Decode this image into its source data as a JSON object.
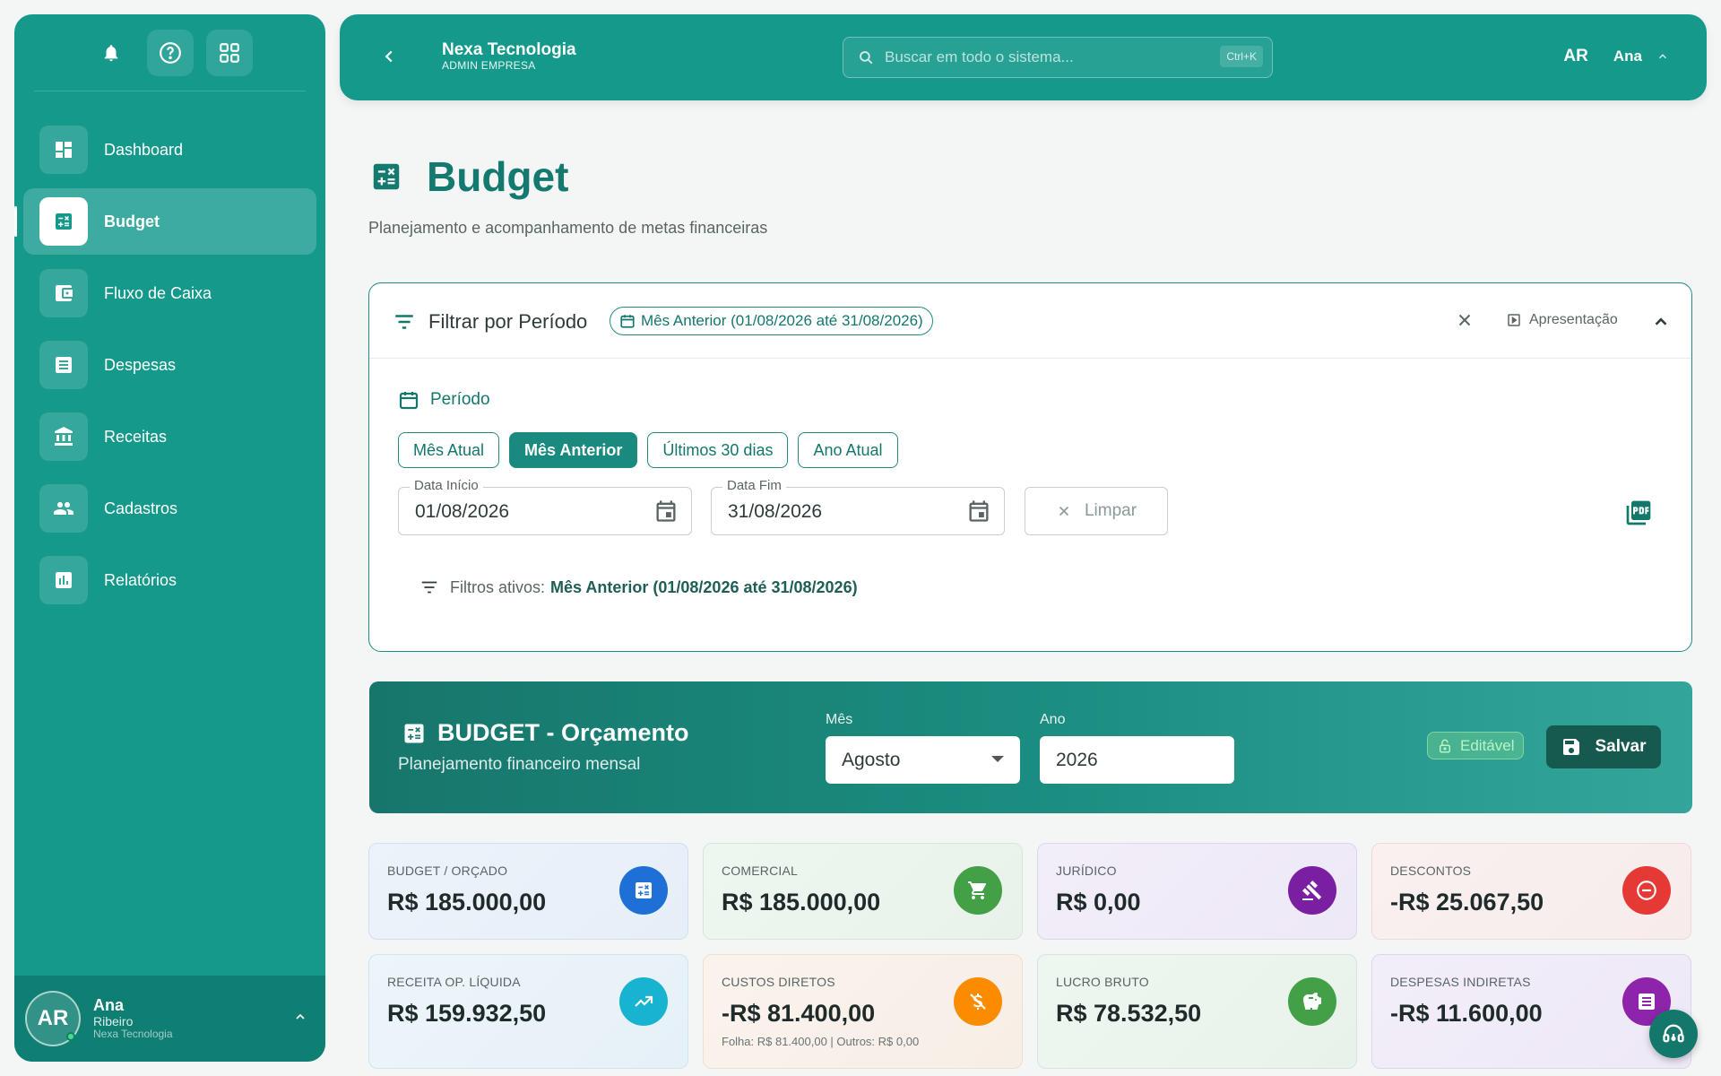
{
  "sidebar": {
    "items": [
      {
        "label": "Dashboard",
        "icon": "dashboard-icon"
      },
      {
        "label": "Budget",
        "icon": "calculator-icon",
        "active": true
      },
      {
        "label": "Fluxo de Caixa",
        "icon": "wallet-icon"
      },
      {
        "label": "Despesas",
        "icon": "receipt-icon"
      },
      {
        "label": "Receitas",
        "icon": "bank-icon"
      },
      {
        "label": "Cadastros",
        "icon": "people-icon"
      },
      {
        "label": "Relatórios",
        "icon": "bar-chart-icon"
      }
    ],
    "user": {
      "initials": "AR",
      "first_name": "Ana",
      "last_name": "Ribeiro",
      "company": "Nexa Tecnologia"
    }
  },
  "header": {
    "company": "Nexa Tecnologia",
    "role": "ADMIN EMPRESA",
    "search_placeholder": "Buscar em todo o sistema...",
    "shortcut": "Ctrl+K",
    "user_initials": "AR",
    "user_name": "Ana"
  },
  "page": {
    "title": "Budget",
    "subtitle": "Planejamento e acompanhamento de metas financeiras"
  },
  "filter": {
    "title": "Filtrar por Período",
    "chip": "Mês Anterior (01/08/2026 até 31/08/2026)",
    "presentation": "Apresentação",
    "period_label": "Período",
    "presets": [
      "Mês Atual",
      "Mês Anterior",
      "Últimos 30 dias",
      "Ano Atual"
    ],
    "start_label": "Data Início",
    "start_value": "01/08/2026",
    "end_label": "Data Fim",
    "end_value": "31/08/2026",
    "clear_label": "Limpar",
    "active_label": "Filtros ativos:",
    "active_value": "Mês Anterior (01/08/2026 até 31/08/2026)"
  },
  "budget": {
    "title": "BUDGET - Orçamento",
    "subtitle": "Planejamento financeiro mensal",
    "month_label": "Mês",
    "month_value": "Agosto",
    "year_label": "Ano",
    "year_value": "2026",
    "editable_label": "Editável",
    "save_label": "Salvar"
  },
  "cards": [
    {
      "label": "BUDGET / ORÇADO",
      "value": "R$ 185.000,00",
      "icon": "calculator-icon",
      "color": "#1e6fd6"
    },
    {
      "label": "COMERCIAL",
      "value": "R$ 185.000,00",
      "icon": "cart-icon",
      "color": "#43a047"
    },
    {
      "label": "JURÍDICO",
      "value": "R$ 0,00",
      "icon": "gavel-icon",
      "color": "#7b1fa2"
    },
    {
      "label": "DESCONTOS",
      "value": "-R$ 25.067,50",
      "icon": "minus-circle-icon",
      "color": "#e53935"
    },
    {
      "label": "RECEITA OP. LÍQUIDA",
      "value": "R$ 159.932,50",
      "icon": "trending-up-icon",
      "color": "#17b3d1"
    },
    {
      "label": "CUSTOS DIRETOS",
      "value": "-R$ 81.400,00",
      "footnote": "Folha: R$ 81.400,00 | Outros: R$ 0,00",
      "icon": "money-off-icon",
      "color": "#fb8c00"
    },
    {
      "label": "LUCRO BRUTO",
      "value": "R$ 78.532,50",
      "icon": "piggy-bank-icon",
      "color": "#43a047"
    },
    {
      "label": "DESPESAS INDIRETAS",
      "value": "-R$ 11.600,00",
      "icon": "receipt-icon",
      "color": "#8e24aa"
    }
  ]
}
